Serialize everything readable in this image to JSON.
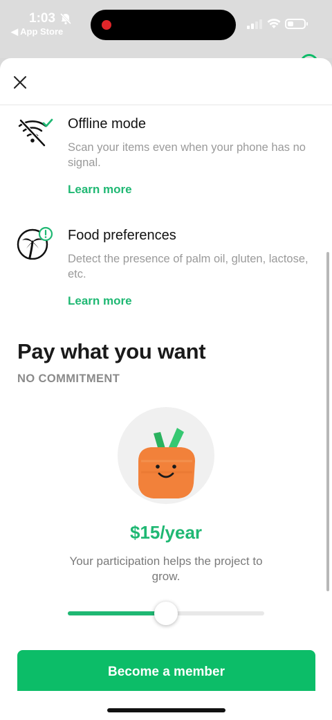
{
  "status_bar": {
    "time": "1:03",
    "back_app": "◀ App Store"
  },
  "sheet": {
    "close_icon": "close-x-icon",
    "features": [
      {
        "icon": "wifi-off-check-icon",
        "title": "Offline mode",
        "description": "Scan your items even when your phone has no signal.",
        "link": "Learn more"
      },
      {
        "icon": "palm-tree-alert-icon",
        "title": "Food preferences",
        "description": "Detect the presence of palm oil, gluten, lactose, etc.",
        "link": "Learn more"
      }
    ],
    "pay": {
      "title": "Pay what you want",
      "subtitle": "NO COMMITMENT",
      "price": "$15/year",
      "help_text": "Your participation helps the project to grow.",
      "slider_fraction": 0.5
    },
    "cta_label": "Become a member"
  },
  "colors": {
    "accent": "#1fb873",
    "button": "#0cbd68",
    "mascot_orange": "#f2813a"
  }
}
